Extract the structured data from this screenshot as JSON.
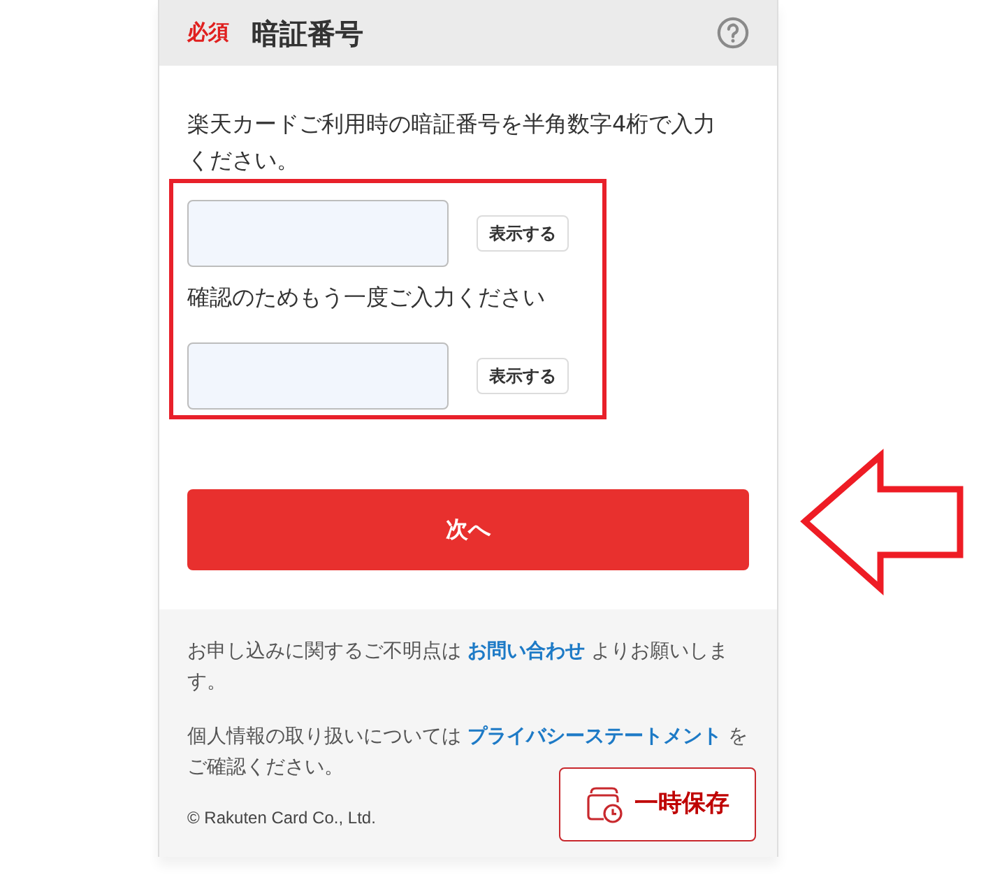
{
  "header": {
    "required_badge": "必須",
    "title": "暗証番号"
  },
  "instruction": "楽天カードご利用時の暗証番号を半角数字4桁で入力ください。",
  "pin_section": {
    "highlighted": true,
    "pin_field": {
      "show_button": "表示する"
    },
    "confirm_label": "確認のためもう一度ご入力ください",
    "confirm_field": {
      "show_button": "表示する"
    }
  },
  "next_button": {
    "label": "次へ",
    "pointed_at": true
  },
  "footer": {
    "paragraphs": [
      [
        {
          "kind": "text",
          "text": "お申し込みに関するご不明点は "
        },
        {
          "kind": "link",
          "text": "お問い合わせ"
        },
        {
          "kind": "text",
          "text": " よりお願いします。"
        }
      ],
      [
        {
          "kind": "text",
          "text": "個人情報の取り扱いについては "
        },
        {
          "kind": "link",
          "text": "プライバシーステートメント"
        },
        {
          "kind": "text",
          "text": " をご確認ください。"
        }
      ]
    ],
    "copyright": "© Rakuten Card Co., Ltd."
  },
  "save_button": "一時保存"
}
